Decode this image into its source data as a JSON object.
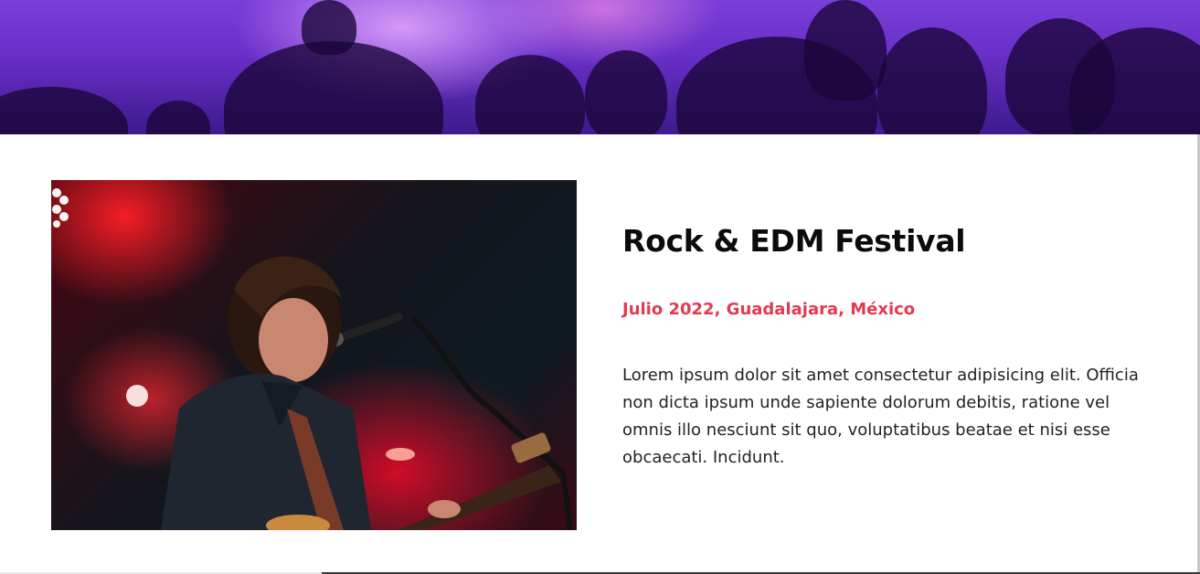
{
  "event": {
    "title": "Rock & EDM Festival",
    "meta": "Julio 2022, Guadalajara, México",
    "description": "Lorem ipsum dolor sit amet consectetur adipisicing elit. Officia non dicta ipsum unde sapiente dolorum debitis, ratione vel omnis illo nesciunt sit quo, voluptatibus beatae et nisi esse obcaecati. Incidunt."
  },
  "colors": {
    "accent": "#e53950",
    "heading": "#0b0b0b",
    "body_text": "#222222",
    "hero_purple": "#7a3fd8"
  }
}
